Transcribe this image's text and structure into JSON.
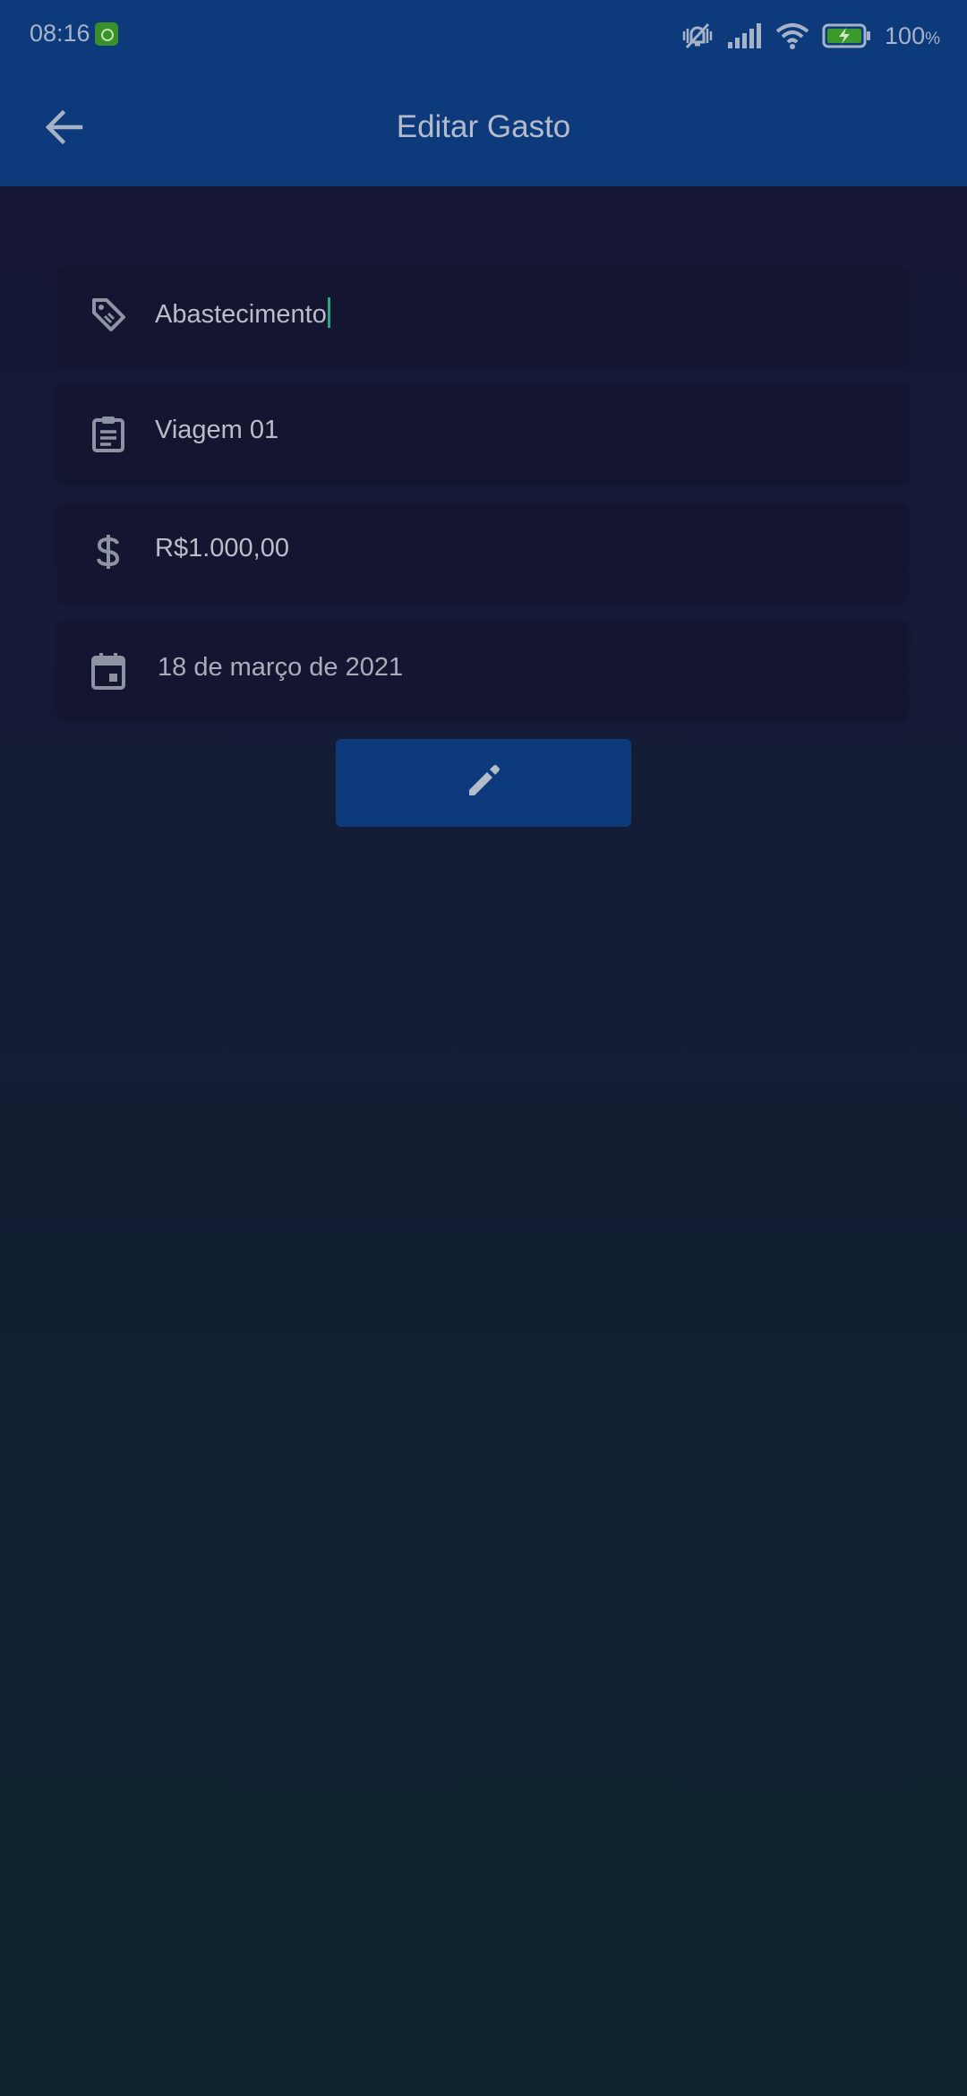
{
  "status_bar": {
    "time": "08:16",
    "battery_percent": "100",
    "battery_unit": "%",
    "icons": [
      "app-notification-icon",
      "mute-vibrate-icon",
      "signal-icon",
      "wifi-icon",
      "battery-charging-icon"
    ]
  },
  "app_bar": {
    "title": "Editar Gasto",
    "back_icon": "arrow-left-icon",
    "background": "#0c3a7b"
  },
  "form": {
    "description": {
      "value": "Abastecimento",
      "icon": "tag-icon"
    },
    "trip": {
      "value": "Viagem 01",
      "icon": "clipboard-icon"
    },
    "amount": {
      "value": "R$1.000,00",
      "icon": "dollar-icon"
    },
    "date": {
      "value": "18 de março de 2021",
      "icon": "calendar-icon"
    }
  },
  "actions": {
    "edit_button_icon": "pencil-icon",
    "edit_button_color": "#0c3a7b"
  },
  "colors": {
    "cursor": "#2ea57f",
    "field_background": "#141631"
  }
}
